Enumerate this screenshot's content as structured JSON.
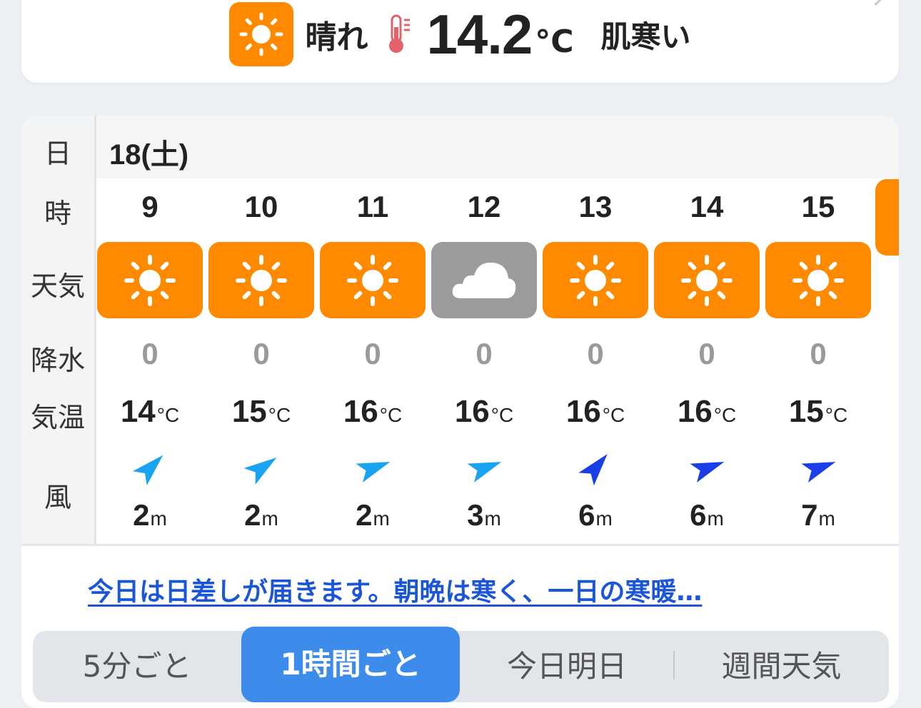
{
  "current": {
    "condition": "晴れ",
    "temperature": "14.2",
    "unit": "°C",
    "feels": "肌寒い"
  },
  "table": {
    "labels": {
      "date": "日",
      "hour": "時",
      "weather": "天気",
      "precip": "降水",
      "temp": "気温",
      "wind": "風"
    },
    "date": "18(土)",
    "temp_unit": "°C",
    "wind_unit": "m",
    "hours": [
      {
        "hour": "9",
        "weather": "sun-icon",
        "precip": "0",
        "temp": "14",
        "wind_speed": "2",
        "wind_color": "#1aa3f0",
        "wind_angle": 45
      },
      {
        "hour": "10",
        "weather": "sun-icon",
        "precip": "0",
        "temp": "15",
        "wind_speed": "2",
        "wind_color": "#1aa3f0",
        "wind_angle": 55
      },
      {
        "hour": "11",
        "weather": "sun-icon",
        "precip": "0",
        "temp": "16",
        "wind_speed": "2",
        "wind_color": "#1aa3f0",
        "wind_angle": 70
      },
      {
        "hour": "12",
        "weather": "cloud-icon",
        "precip": "0",
        "temp": "16",
        "wind_speed": "3",
        "wind_color": "#1aa3f0",
        "wind_angle": 70
      },
      {
        "hour": "13",
        "weather": "sun-icon",
        "precip": "0",
        "temp": "16",
        "wind_speed": "6",
        "wind_color": "#1a3fe6",
        "wind_angle": 40
      },
      {
        "hour": "14",
        "weather": "sun-icon",
        "precip": "0",
        "temp": "16",
        "wind_speed": "6",
        "wind_color": "#1a3fe6",
        "wind_angle": 70
      },
      {
        "hour": "15",
        "weather": "sun-icon",
        "precip": "0",
        "temp": "15",
        "wind_speed": "7",
        "wind_color": "#1a3fe6",
        "wind_angle": 70
      }
    ]
  },
  "summary": "今日は日差しが届きます。朝晩は寒く、一日の寒暖…",
  "tabs": [
    {
      "label": "5分ごと",
      "active": false
    },
    {
      "label": "1時間ごと",
      "active": true
    },
    {
      "label": "今日明日",
      "active": false
    },
    {
      "label": "週間天気",
      "active": false
    }
  ],
  "colors": {
    "sunny": "#ff8a00",
    "cloudy": "#9b9b9b",
    "accent": "#3d8bea",
    "link": "#1a56d6"
  }
}
